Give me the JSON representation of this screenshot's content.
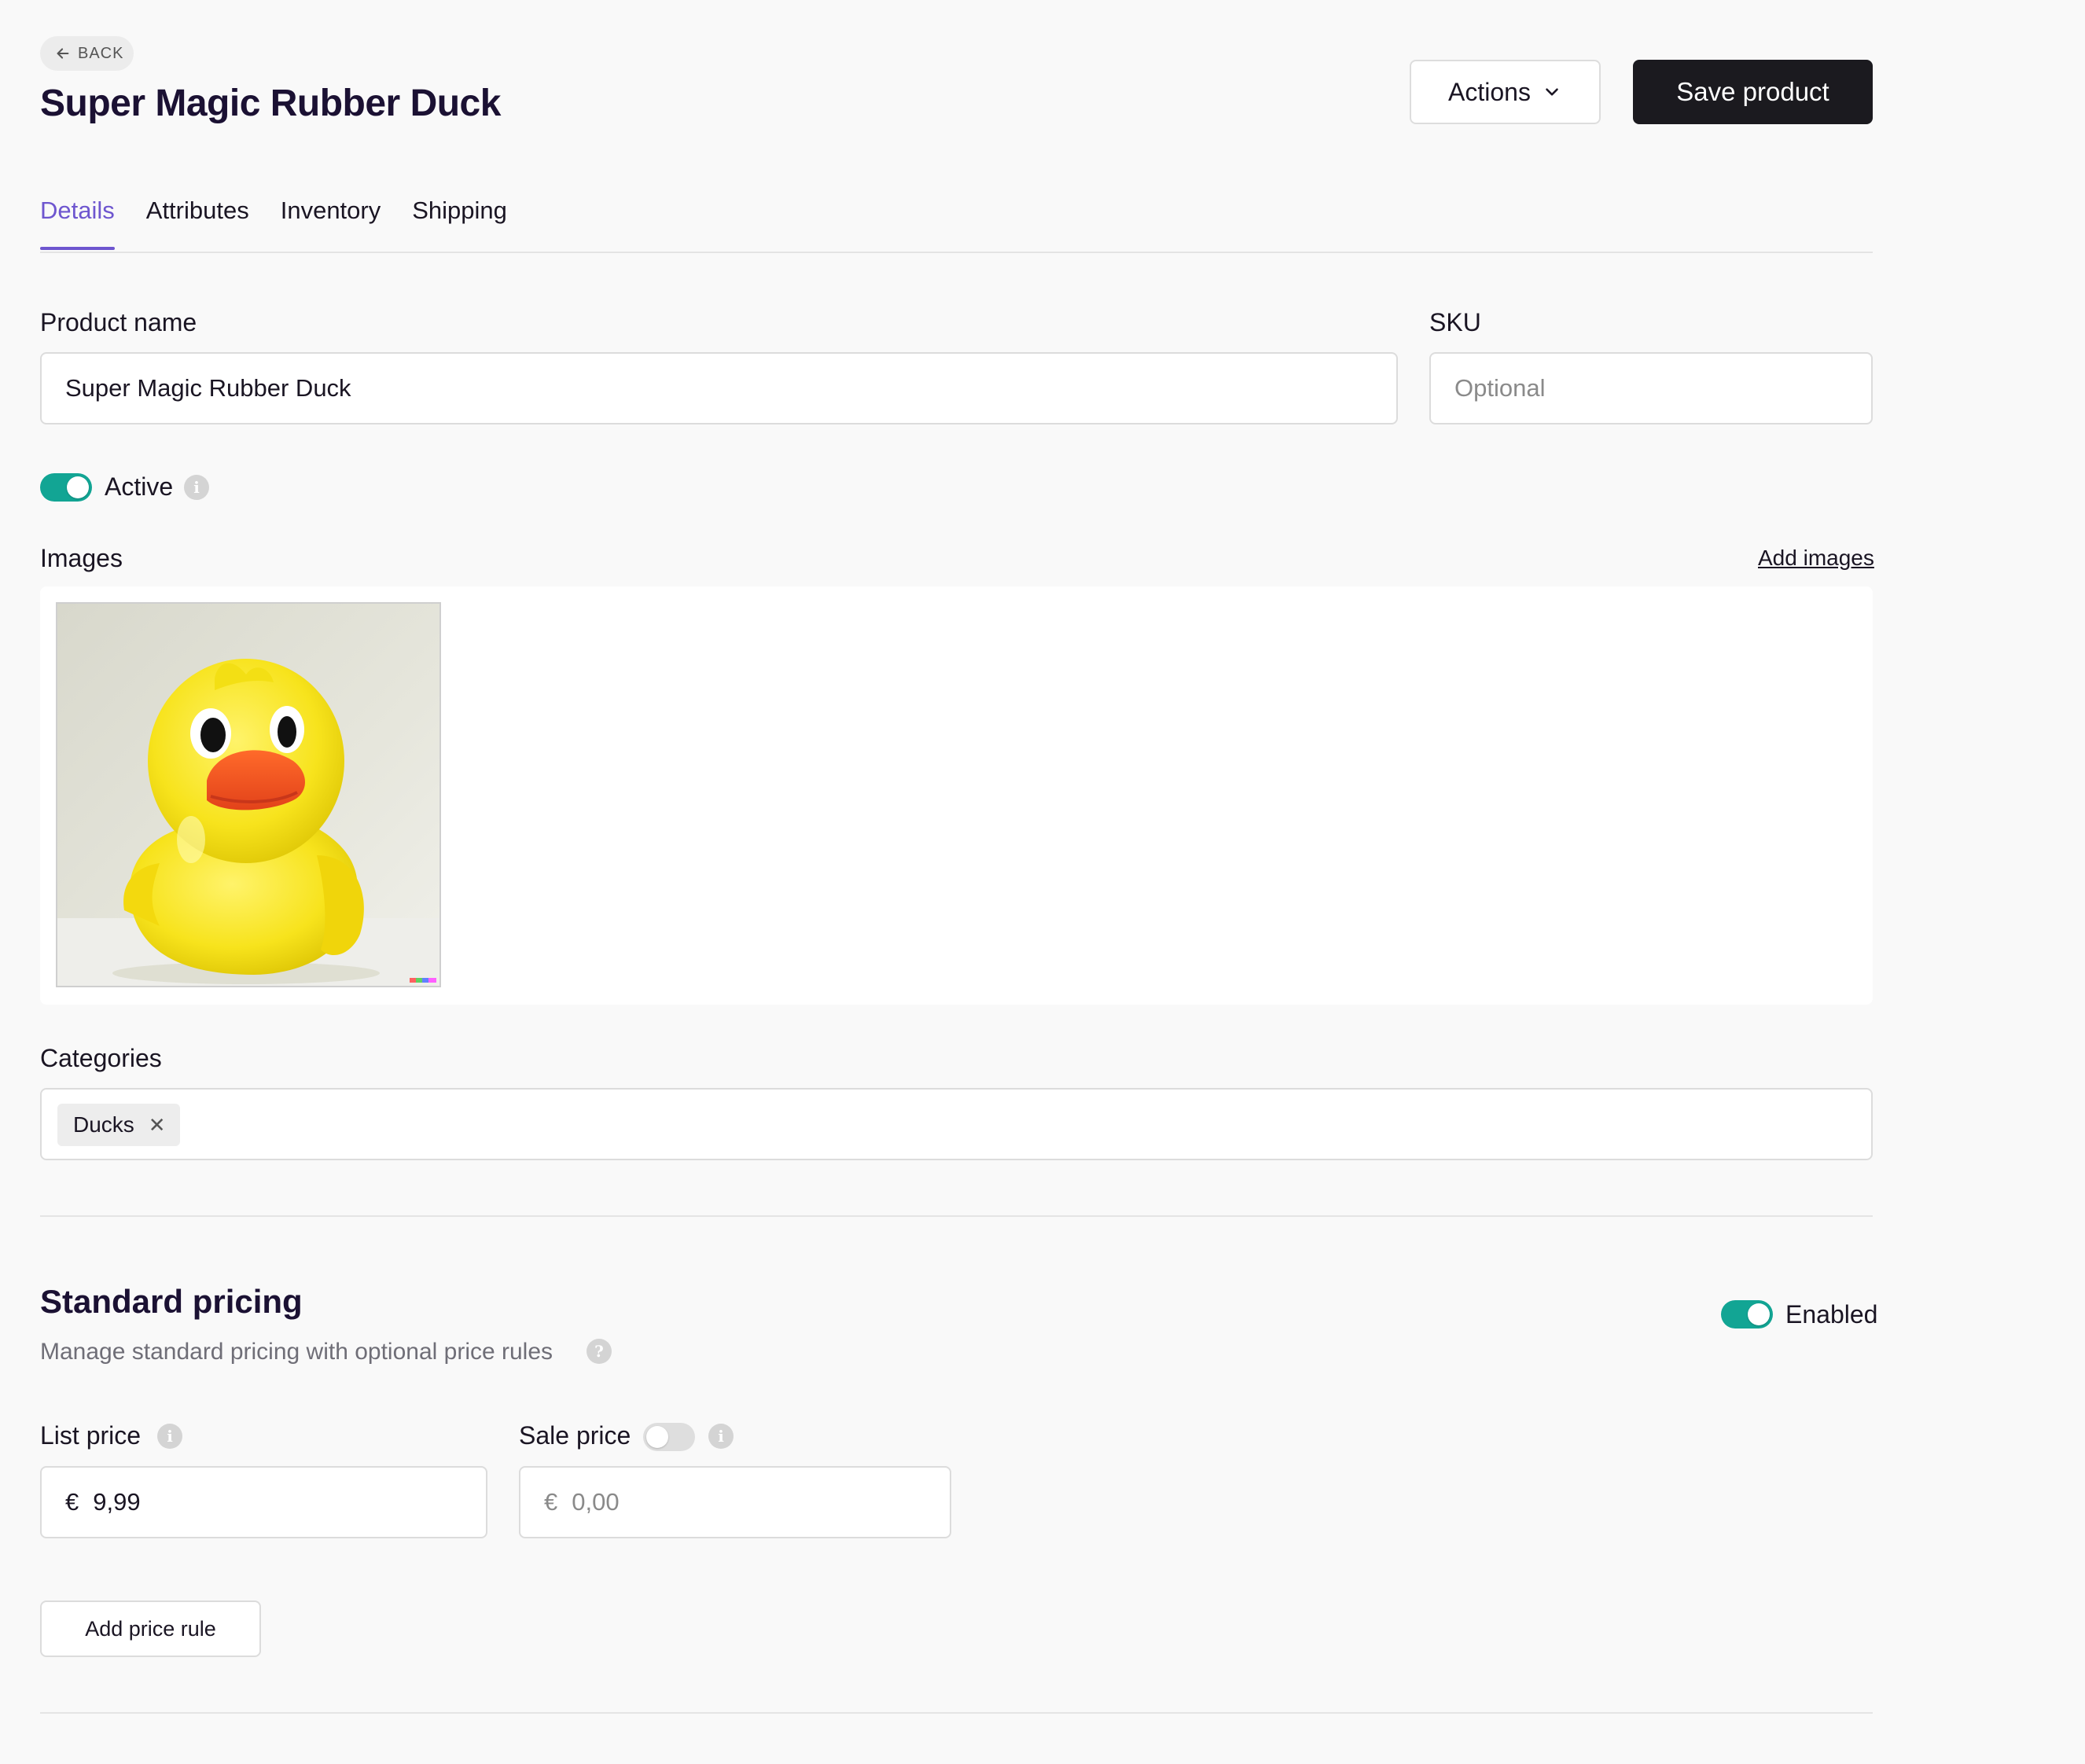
{
  "header": {
    "back_label": "BACK",
    "title": "Super Magic Rubber Duck",
    "actions_label": "Actions",
    "save_label": "Save product"
  },
  "tabs": [
    {
      "label": "Details",
      "active": true
    },
    {
      "label": "Attributes",
      "active": false
    },
    {
      "label": "Inventory",
      "active": false
    },
    {
      "label": "Shipping",
      "active": false
    }
  ],
  "form": {
    "product_name_label": "Product name",
    "product_name_value": "Super Magic Rubber Duck",
    "sku_label": "SKU",
    "sku_placeholder": "Optional",
    "active_label": "Active",
    "active_on": true,
    "images_label": "Images",
    "add_images_label": "Add images",
    "images": [
      {
        "alt": "Yellow rubber duck"
      }
    ],
    "categories_label": "Categories",
    "categories": [
      "Ducks"
    ]
  },
  "pricing": {
    "title": "Standard pricing",
    "subtitle": "Manage standard pricing with optional price rules",
    "enabled_label": "Enabled",
    "enabled_on": true,
    "list_price_label": "List price",
    "list_price_currency": "€",
    "list_price_value": "9,99",
    "sale_price_label": "Sale price",
    "sale_price_on": false,
    "sale_price_currency": "€",
    "sale_price_placeholder": "0,00",
    "add_price_rule_label": "Add price rule"
  },
  "colors": {
    "accent": "#6e56cf",
    "toggle_on": "#12a594",
    "primary_button": "#1b1a1f"
  }
}
